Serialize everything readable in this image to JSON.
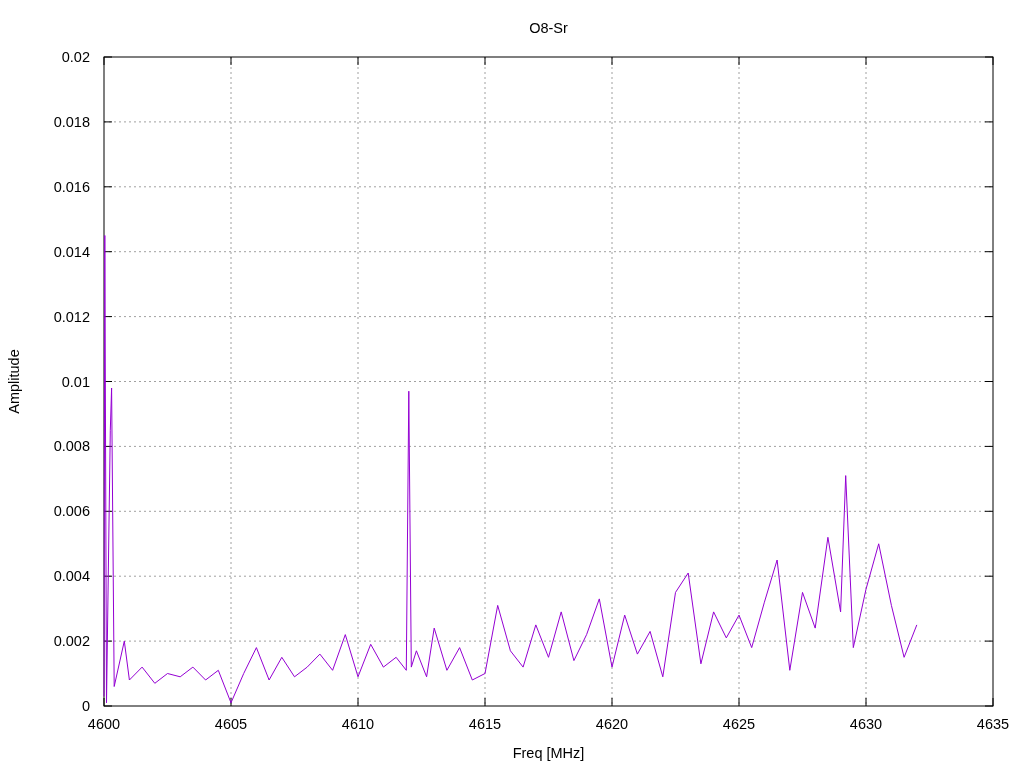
{
  "chart_data": {
    "type": "line",
    "title": "O8-Sr",
    "xlabel": "Freq [MHz]",
    "ylabel": "Amplitude",
    "grid": true,
    "xlim": [
      4600,
      4635
    ],
    "ylim": [
      0,
      0.02
    ],
    "xticks": [
      4600,
      4605,
      4610,
      4615,
      4620,
      4625,
      4630,
      4635
    ],
    "yticks": [
      {
        "value": 0,
        "label": "0"
      },
      {
        "value": 0.002,
        "label": "0.002"
      },
      {
        "value": 0.004,
        "label": "0.004"
      },
      {
        "value": 0.006,
        "label": "0.006"
      },
      {
        "value": 0.008,
        "label": "0.008"
      },
      {
        "value": 0.01,
        "label": "0.01"
      },
      {
        "value": 0.012,
        "label": "0.012"
      },
      {
        "value": 0.014,
        "label": "0.014"
      },
      {
        "value": 0.016,
        "label": "0.016"
      },
      {
        "value": 0.018,
        "label": "0.018"
      },
      {
        "value": 0.02,
        "label": "0.02"
      }
    ],
    "x": [
      4600,
      4600.03,
      4600.1,
      4600.25,
      4600.3,
      4600.4,
      4600.8,
      4601,
      4601.5,
      4602,
      4602.5,
      4603,
      4603.5,
      4604,
      4604.5,
      4605,
      4605.5,
      4606,
      4606.5,
      4607,
      4607.5,
      4608,
      4608.5,
      4609,
      4609.5,
      4610,
      4610.5,
      4611,
      4611.5,
      4611.9,
      4612,
      4612.1,
      4612.3,
      4612.7,
      4613,
      4613.5,
      4614,
      4614.5,
      4615,
      4615.5,
      4616,
      4616.5,
      4617,
      4617.5,
      4618,
      4618.5,
      4619,
      4619.5,
      4620,
      4620.5,
      4621,
      4621.5,
      4622,
      4622.5,
      4623,
      4623.5,
      4624,
      4624.5,
      4625,
      4625.5,
      4626,
      4626.5,
      4627,
      4627.5,
      4628,
      4628.5,
      4629,
      4629.2,
      4629.5,
      4630,
      4630.5,
      4631,
      4631.5,
      4632
    ],
    "series": [
      {
        "color": "#9400d3",
        "values": [
          0.0003,
          0.0145,
          0.0001,
          0.0085,
          0.0098,
          0.0006,
          0.002,
          0.0008,
          0.0012,
          0.0007,
          0.001,
          0.0009,
          0.0012,
          0.0008,
          0.0011,
          0.0001,
          0.001,
          0.0018,
          0.0008,
          0.0015,
          0.0009,
          0.0012,
          0.0016,
          0.0011,
          0.0022,
          0.0009,
          0.0019,
          0.0012,
          0.0015,
          0.0011,
          0.0097,
          0.0012,
          0.0017,
          0.0009,
          0.0024,
          0.0011,
          0.0018,
          0.0008,
          0.001,
          0.0031,
          0.0017,
          0.0012,
          0.0025,
          0.0015,
          0.0029,
          0.0014,
          0.0022,
          0.0033,
          0.0012,
          0.0028,
          0.0016,
          0.0023,
          0.0009,
          0.0035,
          0.0041,
          0.0013,
          0.0029,
          0.0021,
          0.0028,
          0.0018,
          0.0032,
          0.0045,
          0.0011,
          0.0035,
          0.0024,
          0.0052,
          0.0029,
          0.0071,
          0.0018,
          0.0036,
          0.005,
          0.0031,
          0.0015,
          0.0025
        ]
      }
    ]
  }
}
